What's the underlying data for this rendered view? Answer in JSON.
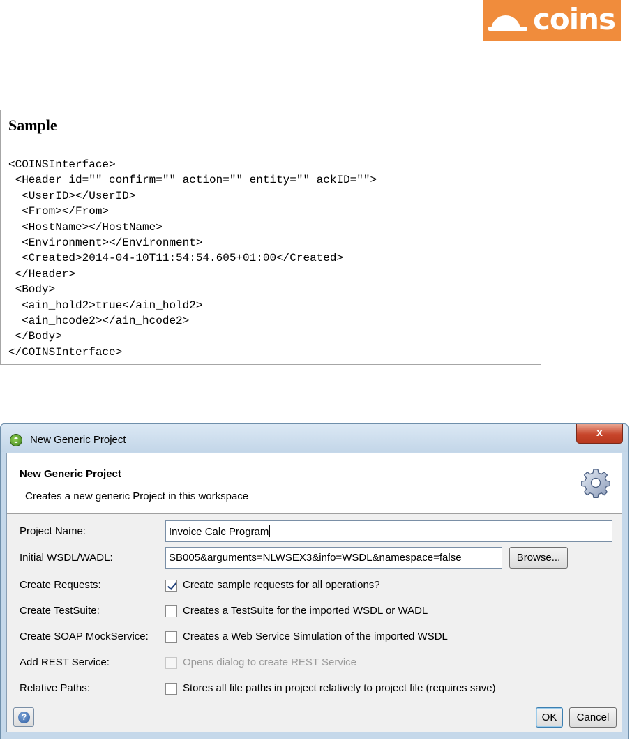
{
  "logo": {
    "text": "coins",
    "color": "#f08c3c"
  },
  "sample": {
    "title": "Sample",
    "code_lines": [
      "<COINSInterface>",
      " <Header id=\"\" confirm=\"\" action=\"\" entity=\"\" ackID=\"\">",
      "  <UserID></UserID>",
      "  <From></From>",
      "  <HostName></HostName>",
      "  <Environment></Environment>",
      "  <Created>2014-04-10T11:54:54.605+01:00</Created>",
      " </Header>",
      " <Body>",
      "  <ain_hold2>true</ain_hold2>",
      "  <ain_hcode2></ain_hcode2>",
      " </Body>",
      "</COINSInterface>"
    ]
  },
  "dialog": {
    "window_title": "New Generic Project",
    "close_label": "x",
    "header": {
      "title": "New Generic Project",
      "description": "Creates a new generic Project in this workspace",
      "icon": "gear-icon"
    },
    "fields": {
      "project_name": {
        "label": "Project Name:",
        "value": "Invoice Calc Program"
      },
      "initial_wsdl": {
        "label": "Initial WSDL/WADL:",
        "value": "SB005&arguments=NLWSEX3&info=WSDL&namespace=false",
        "browse_label": "Browse..."
      }
    },
    "options": [
      {
        "label": "Create Requests:",
        "text": "Create sample requests for all operations?",
        "checked": true,
        "disabled": false
      },
      {
        "label": "Create TestSuite:",
        "text": "Creates a TestSuite for the imported WSDL or WADL",
        "checked": false,
        "disabled": false
      },
      {
        "label": "Create SOAP MockService:",
        "text": "Creates a Web Service Simulation of the imported WSDL",
        "checked": false,
        "disabled": false
      },
      {
        "label": "Add REST Service:",
        "text": "Opens dialog to create REST Service",
        "checked": false,
        "disabled": true
      },
      {
        "label": "Relative Paths:",
        "text": "Stores all file paths in project relatively to project file (requires save)",
        "checked": false,
        "disabled": false
      }
    ],
    "footer": {
      "help_icon": "help-icon",
      "help_label": "?",
      "ok_label": "OK",
      "cancel_label": "Cancel"
    }
  }
}
